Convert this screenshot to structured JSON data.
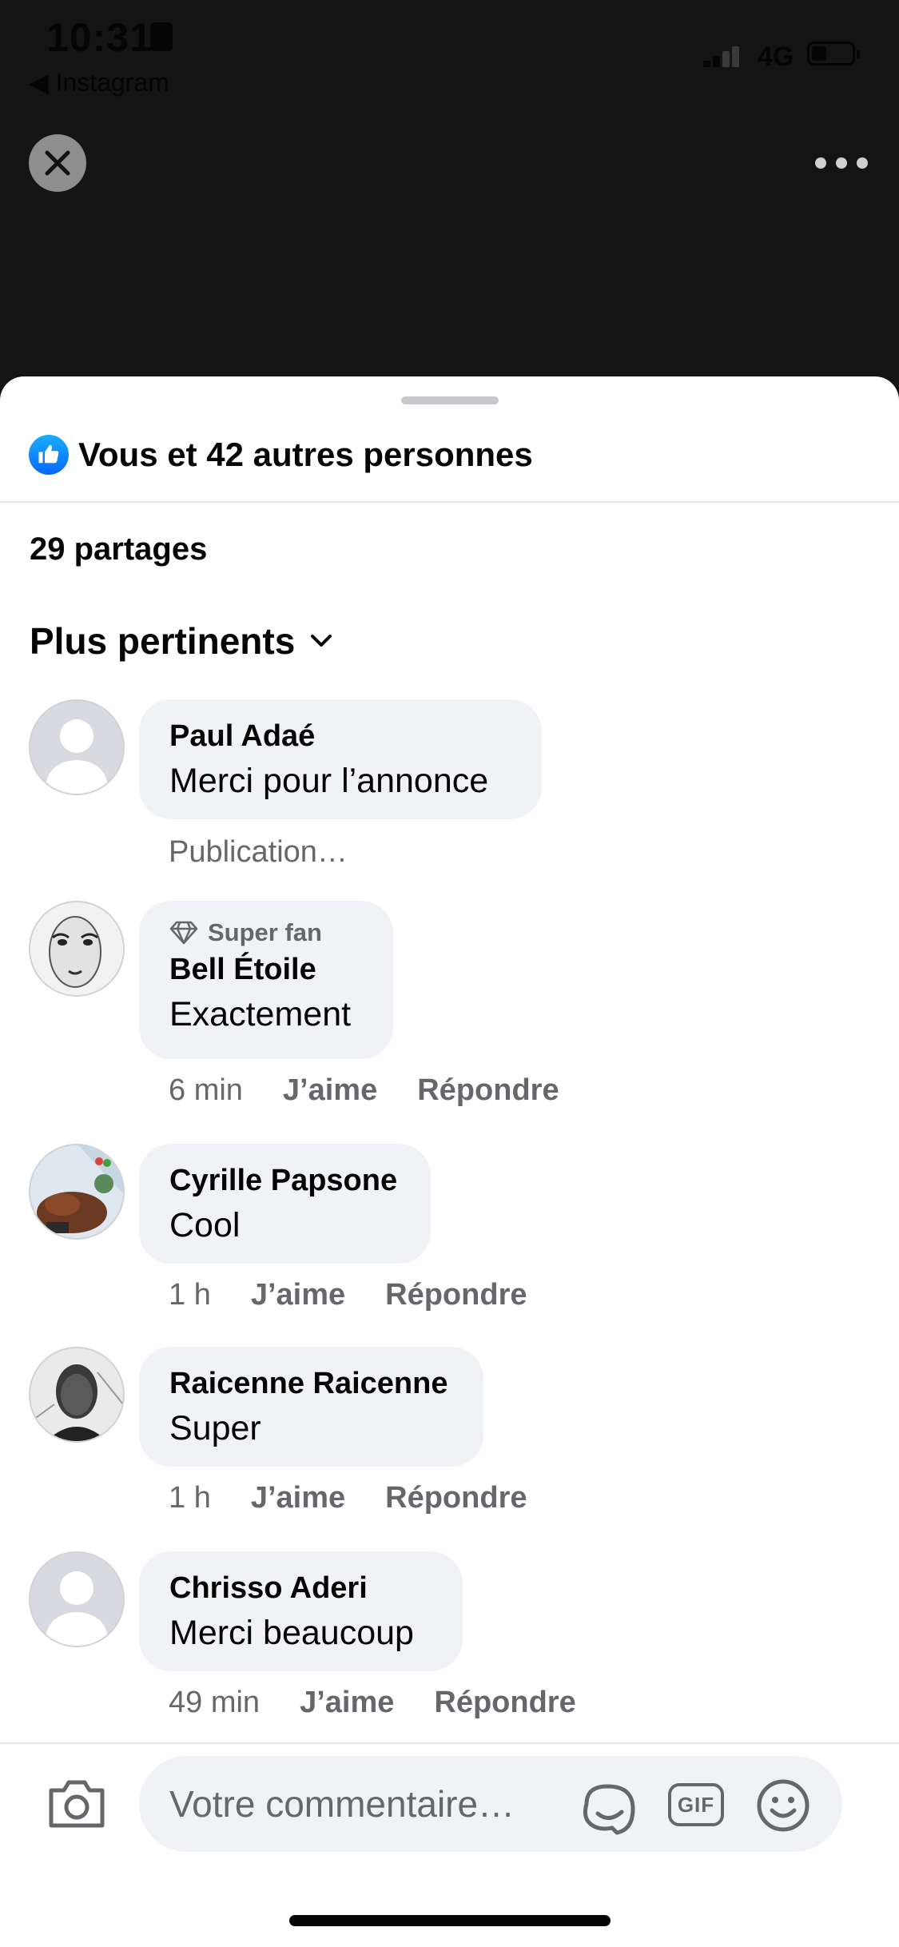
{
  "status_bar": {
    "time": "10:31",
    "back_app": "◀ Instagram",
    "network": "4G"
  },
  "top_bar": {
    "close_icon": "close-icon",
    "more_icon": "more-icon"
  },
  "sheet": {
    "reactions_text": "Vous et 42 autres personnes",
    "shares_text": "29 partages",
    "sort_label": "Plus pertinents"
  },
  "comments": [
    {
      "author": "Paul Adaé",
      "text": "Merci pour l’annonce",
      "status": "Publication…",
      "avatar": "default"
    },
    {
      "badge": "Super fan",
      "author": "Bell Étoile",
      "text": "Exactement",
      "time": "6 min",
      "like": "J’aime",
      "reply": "Répondre",
      "avatar": "photo"
    },
    {
      "author": "Cyrille Papsone",
      "text": "Cool",
      "time": "1 h",
      "like": "J’aime",
      "reply": "Répondre",
      "avatar": "photo"
    },
    {
      "author": "Raicenne Raicenne",
      "text": "Super",
      "time": "1 h",
      "like": "J’aime",
      "reply": "Répondre",
      "avatar": "photo"
    },
    {
      "author": "Chrisso Aderi",
      "text": "Merci beaucoup",
      "time": "49 min",
      "like": "J’aime",
      "reply": "Répondre",
      "avatar": "default"
    }
  ],
  "composer": {
    "placeholder": "Votre commentaire…",
    "icons": [
      "camera-icon",
      "sticker-icon",
      "gif-icon",
      "emoji-icon"
    ],
    "gif_label": "GIF"
  },
  "colors": {
    "accent": "#0866ff",
    "bubble": "#f0f2f5",
    "secondary_text": "#65676b"
  }
}
